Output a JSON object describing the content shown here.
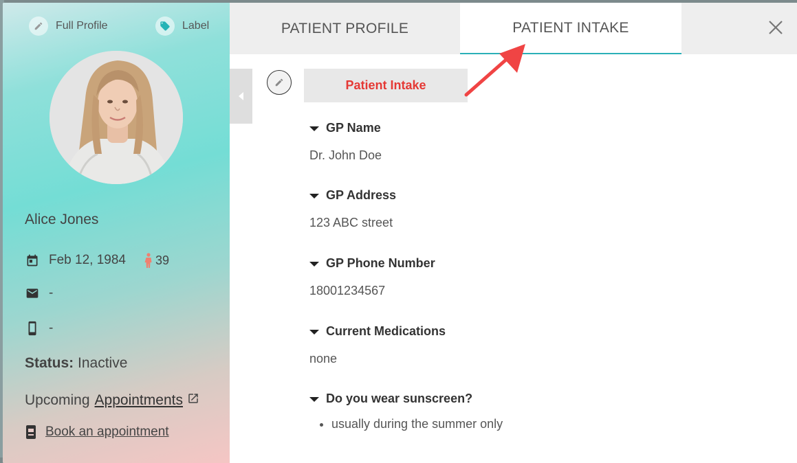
{
  "left_panel": {
    "actions": {
      "full_profile_label": "Full Profile",
      "label_label": "Label"
    },
    "patient": {
      "name": "Alice Jones",
      "dob": "Feb 12, 1984",
      "age": "39",
      "email": "-",
      "phone": "-",
      "status_label": "Status:",
      "status_value": "Inactive"
    },
    "upcoming_label": "Upcoming",
    "appointments_link": "Appointments",
    "book_link": "Book an appointment"
  },
  "tabs": [
    {
      "label": "PATIENT PROFILE",
      "active": false
    },
    {
      "label": "PATIENT INTAKE",
      "active": true
    }
  ],
  "intake": {
    "section_title": "Patient Intake",
    "fields": [
      {
        "label": "GP Name",
        "value": "Dr. John Doe"
      },
      {
        "label": "GP Address",
        "value": "123 ABC street"
      },
      {
        "label": "GP Phone Number",
        "value": "18001234567"
      },
      {
        "label": "Current Medications",
        "value": "none"
      },
      {
        "label": "Do you wear sunscreen?",
        "items": [
          "usually during the summer only"
        ]
      }
    ]
  },
  "colors": {
    "accent_teal": "#2bb0b8",
    "section_title_red": "#e53935",
    "annotation_arrow": "#f04444",
    "age_icon": "#f08070"
  },
  "icons": {
    "full_profile": "pencil-icon",
    "label": "tag-icon",
    "dob": "calendar-icon",
    "age": "person-icon",
    "email": "mail-icon",
    "phone": "mobile-icon",
    "appointments": "external-link-icon",
    "book": "book-icon",
    "close": "close-icon",
    "collapse": "chevron-left-icon",
    "edit": "pencil-icon",
    "field": "caret-down-icon"
  }
}
